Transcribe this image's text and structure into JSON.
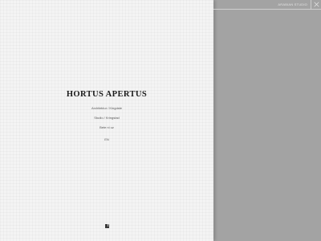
{
  "topbar": {
    "link_label": "ARABIAN STUDIO",
    "close_label": "close"
  },
  "brand": {
    "title": "HORTUS APERTUS"
  },
  "nav": {
    "items": [
      {
        "label": "Architektur / Kingdale"
      },
      {
        "label": "Studio / Kringstad"
      },
      {
        "label": "Bete ni uz"
      }
    ]
  },
  "language": {
    "label": "EN"
  },
  "social": {
    "icon": "facebook-icon",
    "glyph": "f"
  },
  "colors": {
    "left_panel_bg": "#f4f4f4",
    "right_panel_bg": "#a3a3a3",
    "text": "#1b1b1b",
    "muted_text": "#555555"
  }
}
